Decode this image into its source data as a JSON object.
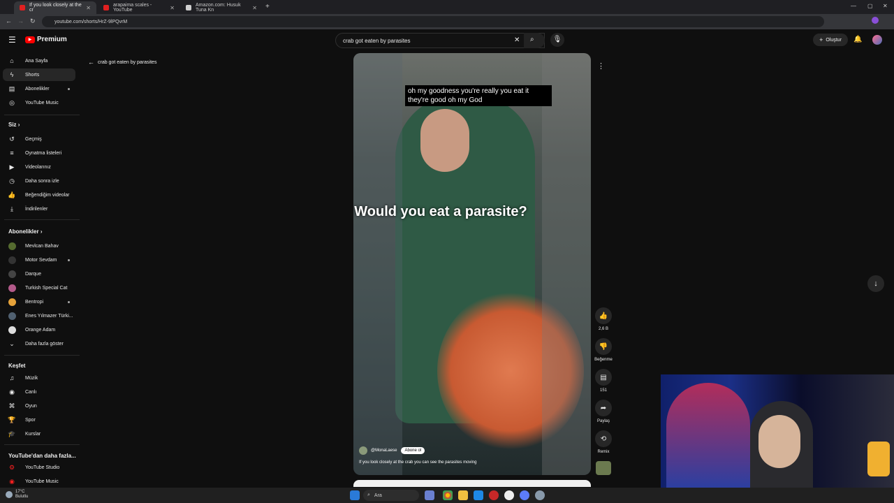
{
  "browser": {
    "tabs": [
      {
        "title": "If you look closely at the cr",
        "active": true
      },
      {
        "title": "arapaima scales - YouTube",
        "active": false
      },
      {
        "title": "Amazon.com: Husuk Tuna Kn",
        "active": false
      }
    ],
    "url": "youtube.com/shorts/HrZ-9lPQvrM"
  },
  "header": {
    "brand": "Premium",
    "search_value": "crab got eaten by parasites",
    "create_label": "Oluştur"
  },
  "breadcrumb": "crab got eaten by parasites",
  "sidebar": {
    "main": [
      {
        "label": "Ana Sayfa",
        "icon": "home-icon"
      },
      {
        "label": "Shorts",
        "icon": "shorts-icon",
        "active": true
      },
      {
        "label": "Abonelikler",
        "icon": "subscriptions-icon"
      },
      {
        "label": "YouTube Music",
        "icon": "music-icon"
      }
    ],
    "you_title": "Siz",
    "you": [
      {
        "label": "Geçmiş"
      },
      {
        "label": "Oynatma listeleri"
      },
      {
        "label": "Videolarınız"
      },
      {
        "label": "Daha sonra izle"
      },
      {
        "label": "Beğendiğim videolar"
      },
      {
        "label": "İndirilenler"
      }
    ],
    "subs_title": "Abonelikler",
    "subs": [
      {
        "label": "Mevlcan Bahav",
        "color": "#556b2f"
      },
      {
        "label": "Motor Sevdam",
        "color": "#333333"
      },
      {
        "label": "Darque",
        "color": "#444444"
      },
      {
        "label": "Turkish Special Cat",
        "color": "#b35a8a"
      },
      {
        "label": "Bentropi",
        "color": "#e5a23a"
      },
      {
        "label": "Enes Yılmazer Türki...",
        "color": "#506070"
      },
      {
        "label": "Orange Adam",
        "color": "#dddddd"
      }
    ],
    "more_label": "Daha fazla göster",
    "explore_title": "Keşfet",
    "explore": [
      {
        "label": "Müzik"
      },
      {
        "label": "Canlı"
      },
      {
        "label": "Oyun"
      },
      {
        "label": "Spor"
      },
      {
        "label": "Kurslar"
      }
    ],
    "more_from_title": "YouTube'dan daha fazla...",
    "more_from": [
      {
        "label": "YouTube Studio"
      },
      {
        "label": "YouTube Music"
      }
    ]
  },
  "video": {
    "caption": "oh my goodness you're really you eat it they're good oh my God",
    "overlay_title": "Would you eat a parasite?",
    "channel": "@MonaLaese",
    "subscribe_label": "Abone ol",
    "description": "If you look closely at the crab you can see the parasites moving"
  },
  "actions": {
    "likes": "2,6 B",
    "dislike_label": "Beğenme",
    "comments": "151",
    "share_label": "Paylaş",
    "remix_label": "Remix"
  },
  "taskbar": {
    "search_label": "Ara",
    "weather_temp": "17°C",
    "weather_desc": "Bulutlu"
  }
}
